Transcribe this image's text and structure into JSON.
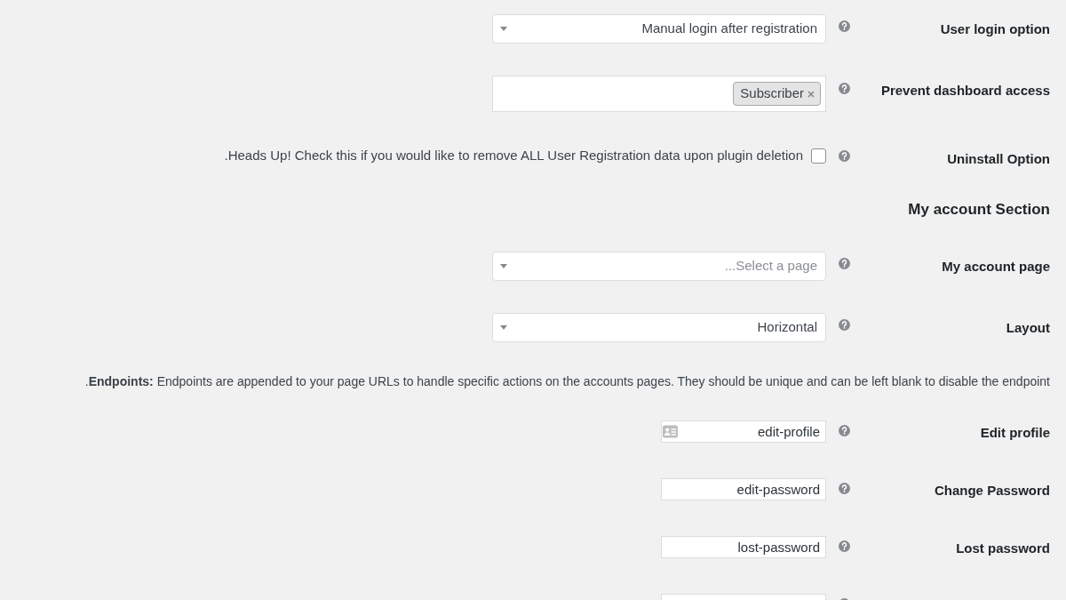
{
  "settings": [
    {
      "kind": "select",
      "label": "User login option",
      "value": "Manual login after registration",
      "help": true
    },
    {
      "kind": "multiselect",
      "label": "Prevent dashboard access",
      "tags": [
        "Subscriber"
      ],
      "help": true
    },
    {
      "kind": "checkbox",
      "label": "Uninstall Option",
      "description": ".Heads Up! Check this if you would like to remove ALL User Registration data upon plugin deletion",
      "checked": false,
      "help": true
    },
    {
      "kind": "heading",
      "title": "My account Section"
    },
    {
      "kind": "select",
      "label": "My account page",
      "placeholder": "...Select a page",
      "help": true
    },
    {
      "kind": "select",
      "label": "Layout",
      "value": "Horizontal",
      "help": true
    },
    {
      "kind": "note",
      "text": ".**Endpoints:** Endpoints are appended to your page URLs to handle specific actions on the accounts pages. They should be unique and can be left blank to disable the endpoint"
    },
    {
      "kind": "text",
      "label": "Edit profile",
      "value": "edit-profile",
      "card_icon": true,
      "help": true
    },
    {
      "kind": "text",
      "label": "Change Password",
      "value": "edit-password",
      "card_icon": false,
      "help": true
    },
    {
      "kind": "text",
      "label": "Lost password",
      "value": "lost-password",
      "card_icon": false,
      "help": true
    },
    {
      "kind": "text",
      "card_icon": false,
      "help": true
    }
  ]
}
